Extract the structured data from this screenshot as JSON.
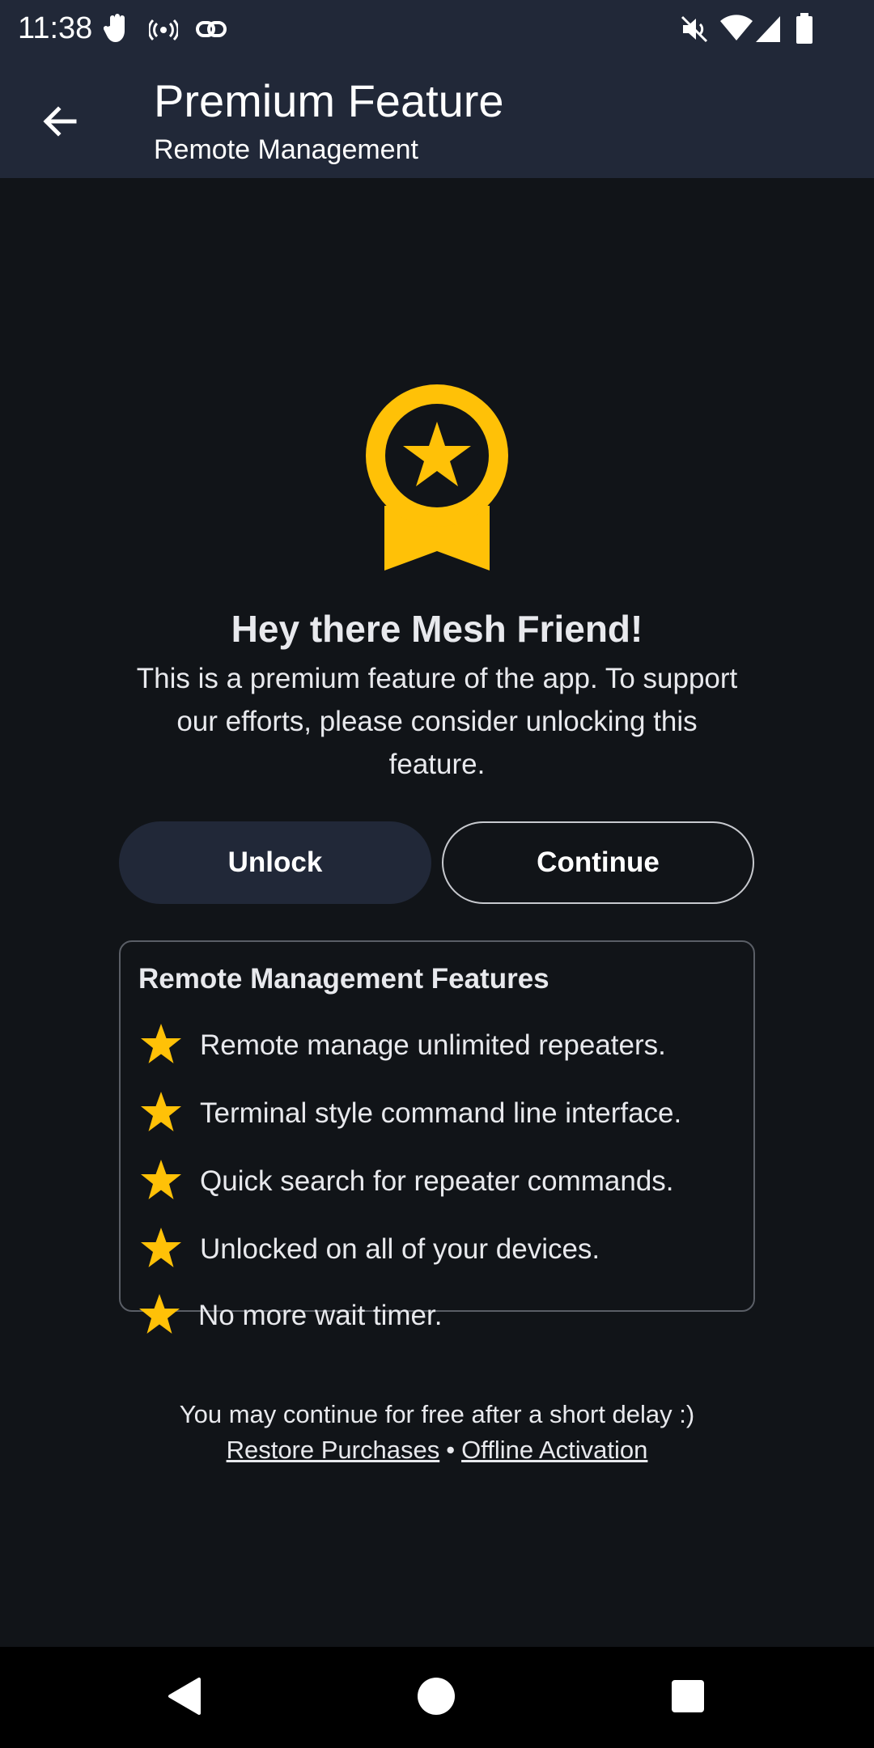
{
  "status_bar": {
    "time": "11:38",
    "icons": [
      "hand-icon",
      "broadcast-icon",
      "link-icon",
      "mute-icon",
      "wifi-icon",
      "signal-icon",
      "battery-icon"
    ]
  },
  "app_bar": {
    "title": "Premium Feature",
    "subtitle": "Remote Management",
    "back_icon": "arrow-back-icon"
  },
  "main": {
    "badge_icon": "award-badge-icon",
    "headline": "Hey there Mesh Friend!",
    "message": "This is a premium feature of the app. To support our efforts, please consider unlocking this feature.",
    "unlock_label": "Unlock",
    "continue_label": "Continue"
  },
  "features": {
    "title": "Remote Management Features",
    "items": [
      "Remote manage unlimited repeaters.",
      "Terminal style command line interface.",
      "Quick search for repeater commands.",
      "Unlocked on all of your devices.",
      "No more wait timer."
    ]
  },
  "footer": {
    "note": "You may continue for free after a short delay :)",
    "restore_label": "Restore Purchases",
    "separator": "•",
    "offline_label": "Offline Activation"
  },
  "colors": {
    "accent": "#FFC107",
    "bar_background": "#212838",
    "background": "#111418"
  },
  "nav_bar": {
    "icons": [
      "back-triangle-icon",
      "home-circle-icon",
      "recents-square-icon"
    ]
  }
}
